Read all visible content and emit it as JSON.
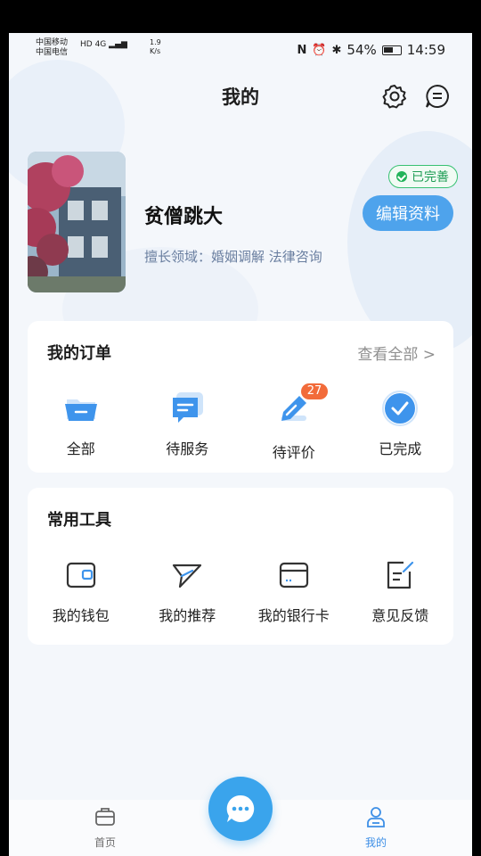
{
  "status_bar": {
    "carrier1": "中国移动",
    "carrier2": "中国电信",
    "hd": "HD",
    "net": "4G",
    "speed_value": "1.9",
    "speed_unit": "K/s",
    "battery": "54%",
    "time": "14:59"
  },
  "header": {
    "title": "我的"
  },
  "profile": {
    "name": "贫僧跳大",
    "field": "擅长领域：婚姻调解 法律咨询",
    "badge": "已完善",
    "edit_label": "编辑资料"
  },
  "orders": {
    "title": "我的订单",
    "view_all": "查看全部 >",
    "items": [
      {
        "label": "全部",
        "icon": "folder-icon"
      },
      {
        "label": "待服务",
        "icon": "message-icon"
      },
      {
        "label": "待评价",
        "icon": "pen-icon",
        "badge": "27"
      },
      {
        "label": "已完成",
        "icon": "check-circle-icon"
      }
    ]
  },
  "tools": {
    "title": "常用工具",
    "items": [
      {
        "label": "我的钱包",
        "icon": "wallet-icon"
      },
      {
        "label": "我的推荐",
        "icon": "send-icon"
      },
      {
        "label": "我的银行卡",
        "icon": "bank-card-icon"
      },
      {
        "label": "意见反馈",
        "icon": "feedback-icon"
      }
    ]
  },
  "tabbar": {
    "home_label": "首页",
    "mine_label": "我的"
  },
  "colors": {
    "accent": "#3e8fe6",
    "success": "#22b35a",
    "badge": "#f26b3a"
  }
}
